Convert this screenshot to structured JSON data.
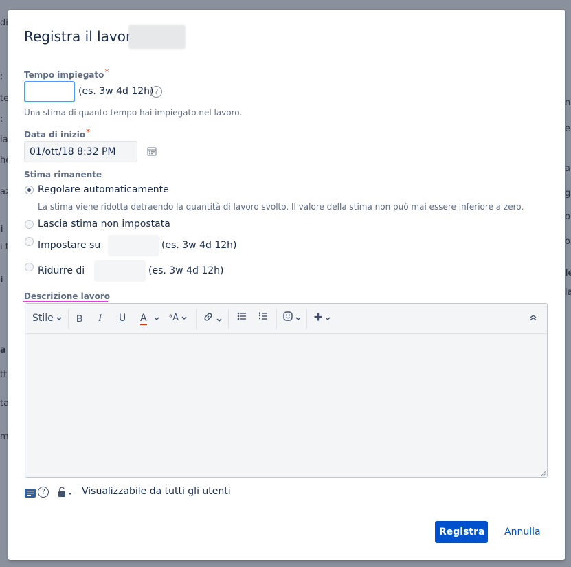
{
  "background": {
    "left_fragments": [
      "di",
      ":",
      "te",
      ":",
      "ia",
      "he",
      "az",
      "i",
      "i te",
      "i",
      "a",
      "tte",
      "ta",
      "m"
    ],
    "right_fragments": [
      "n",
      "e",
      "a",
      "gi",
      "or",
      "or",
      "le",
      "la"
    ]
  },
  "dialog": {
    "title": "Registra il lavoro:",
    "time_spent": {
      "label": "Tempo impiegato",
      "required_mark": "*",
      "value": "",
      "example": "(es. 3w 4d 12h)",
      "help_glyph": "?",
      "description": "Una stima di quanto tempo hai impiegato nel lavoro."
    },
    "start_date": {
      "label": "Data di inizio",
      "required_mark": "*",
      "value": "01/ott/18 8:32 PM"
    },
    "remaining_estimate": {
      "label": "Stima rimanente",
      "options": [
        {
          "label": "Regolare automaticamente",
          "checked": true,
          "description": "La stima viene ridotta detraendo la quantità di lavoro svolto. Il valore della stima non può mai essere inferiore a zero."
        },
        {
          "label": "Lascia stima non impostata",
          "checked": false
        },
        {
          "label": "Impostare su",
          "checked": false,
          "example": "(es. 3w 4d 12h)"
        },
        {
          "label": "Ridurre di",
          "checked": false,
          "example": "(es. 3w 4d 12h)"
        }
      ]
    },
    "work_description": {
      "label": "Descrizione lavoro",
      "toolbar": {
        "style_label": "Stile",
        "bold": "B",
        "italic": "I",
        "underline": "U",
        "text_color": "A",
        "text_color_bar": "#de350b",
        "more_format": "ᵃA"
      }
    },
    "visibility": "Visualizzabile da tutti gli utenti",
    "buttons": {
      "submit": "Registra",
      "cancel": "Annulla"
    }
  },
  "colors": {
    "primary": "#0052cc",
    "focus_border": "#4c9aff",
    "required": "#de350b",
    "highlight_underline": "#e53be1"
  }
}
